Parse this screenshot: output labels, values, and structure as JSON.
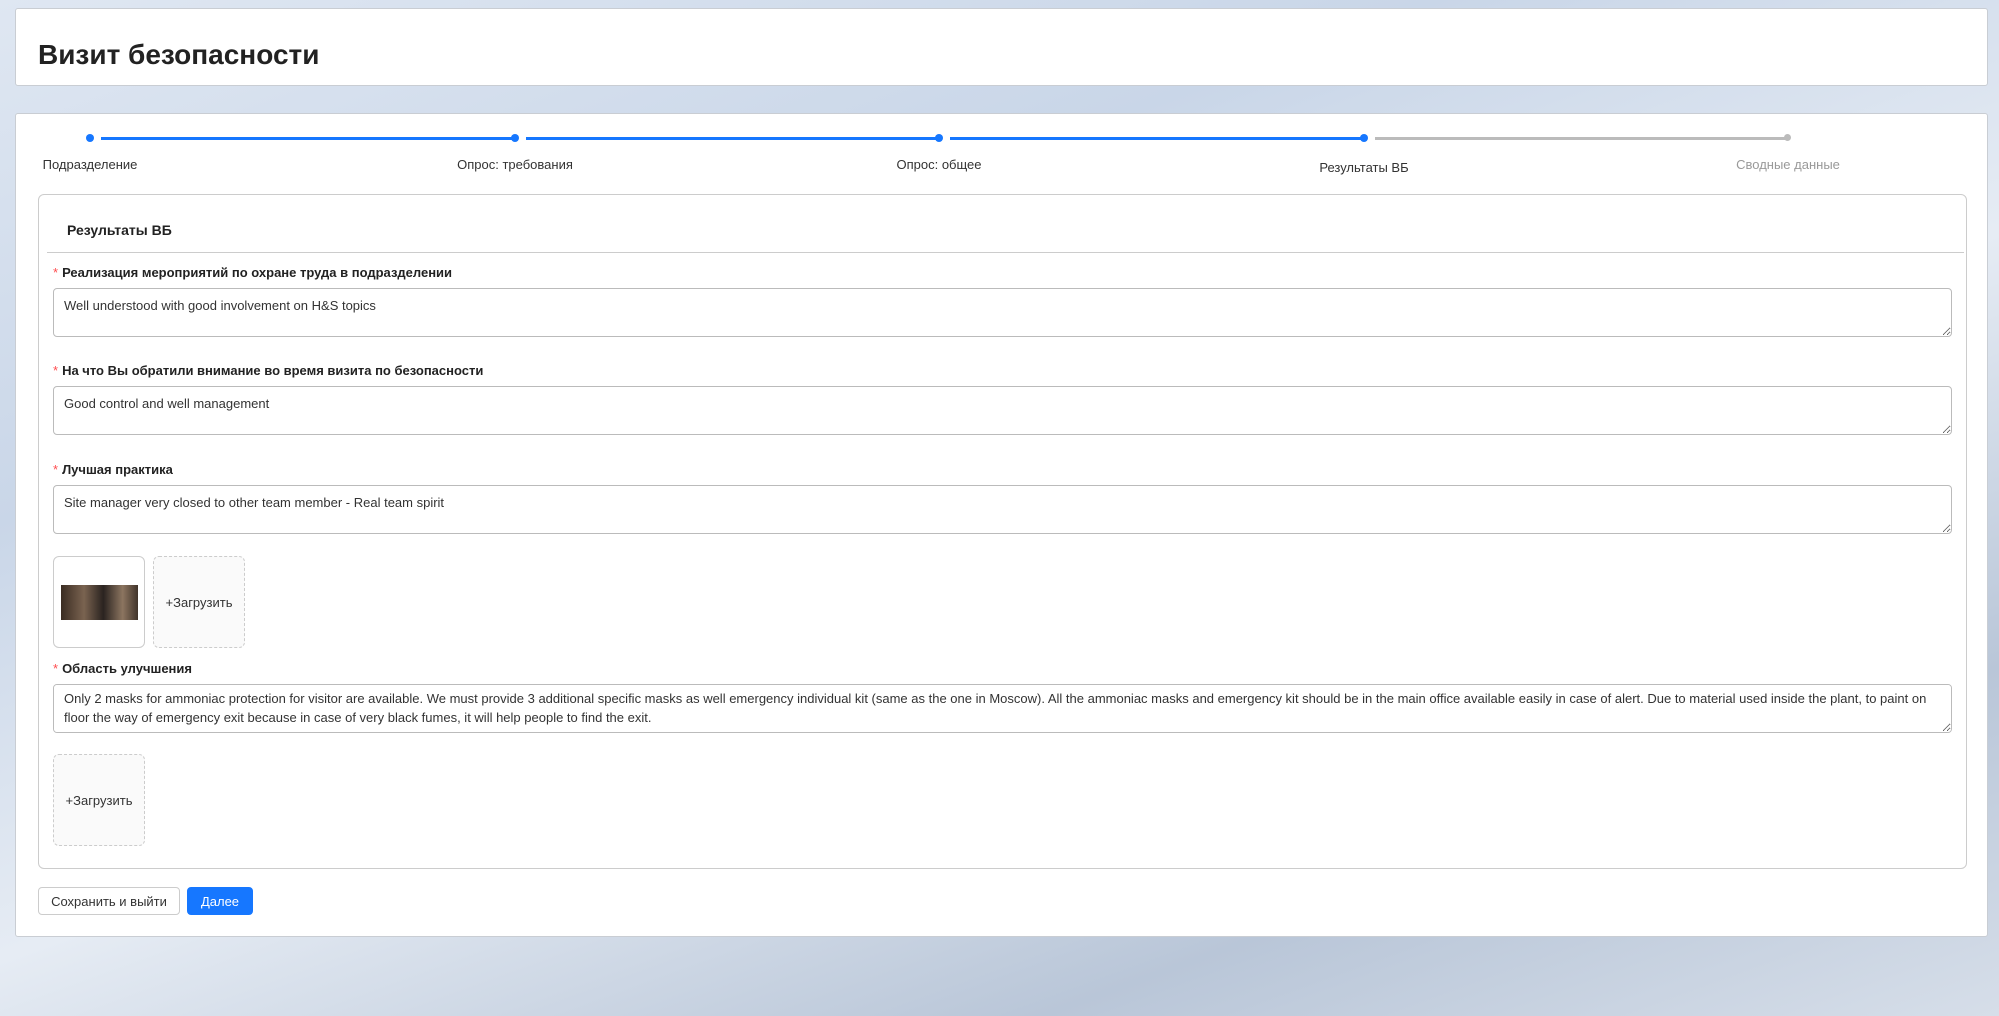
{
  "header": {
    "title": "Визит безопасности"
  },
  "steps": [
    {
      "label": "Подразделение",
      "status": "done"
    },
    {
      "label": "Опрос: требования",
      "status": "done"
    },
    {
      "label": "Опрос: общее",
      "status": "done"
    },
    {
      "label": "Результаты ВБ",
      "status": "current"
    },
    {
      "label": "Сводные данные",
      "status": "pending"
    }
  ],
  "section": {
    "title": "Результаты ВБ"
  },
  "fields": [
    {
      "label": "Реализация мероприятий по охране труда в подразделении",
      "value": "Well understood with good involvement on H&S topics"
    },
    {
      "label": "На что Вы обратили внимание во время визита по безопасности",
      "value": "Good control and well management"
    },
    {
      "label": "Лучшая практика",
      "value": "Site manager very closed to other team member - Real team spirit"
    },
    {
      "label": "Область улучшения",
      "value": "Only 2 masks for ammoniac protection for visitor are available. We must provide 3 additional specific masks as well emergency individual kit (same as the one in Moscow). All the ammoniac masks and emergency kit should be in the main office available easily in case of alert. Due to material used inside the plant, to paint on floor the way of emergency exit because in case of very black fumes, it will help people to find the exit."
    }
  ],
  "required_mark": "*",
  "upload": {
    "label": "+Загрузить"
  },
  "buttons": {
    "save": "Сохранить и выйти",
    "next": "Далее"
  },
  "colors": {
    "accent": "#1677ff",
    "required": "#ff4d4f"
  }
}
